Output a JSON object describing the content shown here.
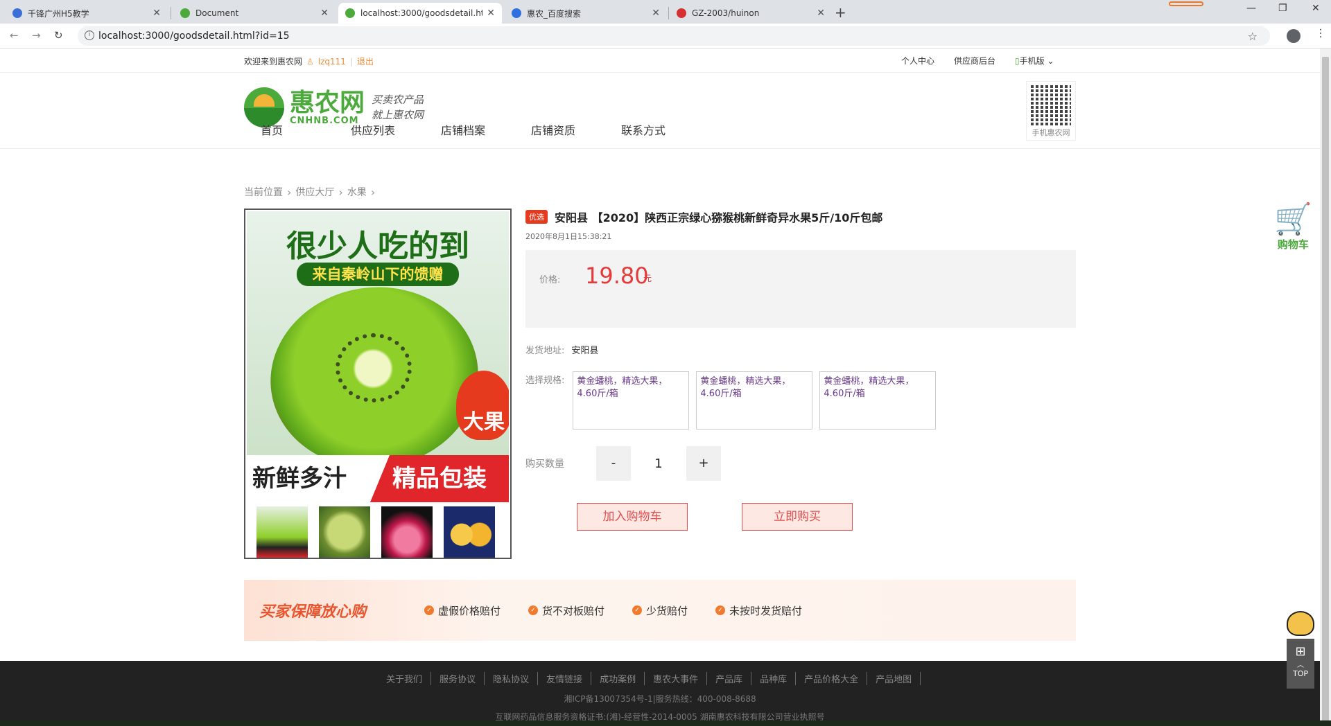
{
  "browser": {
    "tabs": [
      {
        "title": "千锋广州H5教学",
        "fav_color": "#3b6fd8"
      },
      {
        "title": "Document",
        "fav_color": "#4caa3c"
      },
      {
        "title": "localhost:3000/goodsdetail.htm",
        "fav_color": "#4caa3c",
        "active": true
      },
      {
        "title": "惠农_百度搜索",
        "fav_color": "#2f6fe0"
      },
      {
        "title": "GZ-2003/huinon",
        "fav_color": "#d63030"
      }
    ],
    "new_tab": "+",
    "url": "localhost:3000/goodsdetail.html?id=15"
  },
  "topbar": {
    "welcome": "欢迎来到惠农网",
    "username": "lzq111",
    "logout": "退出",
    "links": [
      "个人中心",
      "供应商后台",
      "手机版"
    ]
  },
  "header": {
    "logo_cn": "惠农网",
    "logo_en": "CNHNB.COM",
    "slogan_1": "买卖农产品",
    "slogan_2": "就上惠农网",
    "qr_caption": "手机惠农网"
  },
  "mainnav": [
    "首页",
    "供应列表",
    "店铺档案",
    "店铺资质",
    "联系方式"
  ],
  "breadcrumb": [
    "当前位置",
    "供应大厅",
    "水果"
  ],
  "gallery": {
    "headline": "很少人吃的到",
    "subline": "来自秦岭山下的馈赠",
    "badge": "大果",
    "left_slogan": "新鲜多汁",
    "right_slogan": "精品包装"
  },
  "product": {
    "tag": "优选",
    "title": "安阳县 【2020】陕西正宗绿心猕猴桃新鲜奇异水果5斤/10斤包邮",
    "date": "2020年8月1日15:38:21",
    "price_label": "价格:",
    "price": "19.80",
    "price_unit": "元",
    "ship_label": "发货地址:",
    "ship_value": "安阳县",
    "spec_label": "选择规格:",
    "specs": [
      "黄金蟠桃，精选大果，4.60斤/箱",
      "黄金蟠桃，精选大果，4.60斤/箱",
      "黄金蟠桃，精选大果，4.60斤/箱"
    ],
    "qty_label": "购买数量",
    "qty_minus": "-",
    "qty": "1",
    "qty_plus": "+",
    "add_cart": "加入购物车",
    "buy_now": "立即购买"
  },
  "guarantee": {
    "title": "买家保障放心购",
    "items": [
      "虚假价格赔付",
      "货不对板赔付",
      "少货赔付",
      "未按时发货赔付"
    ]
  },
  "footer": {
    "links": [
      "关于我们",
      "服务协议",
      "隐私协议",
      "友情链接",
      "成功案例",
      "惠农大事件",
      "产品库",
      "品种库",
      "产品价格大全",
      "产品地图"
    ],
    "line1": "湘ICP备13007354号-1|服务热线：400-008-8688",
    "line2": "互联网药品信息服务资格证书:(湘)-经营性-2014-0005 湖南惠农科技有限公司营业执照号"
  },
  "floating": {
    "cart_label": "购物车",
    "top_label": "TOP"
  }
}
